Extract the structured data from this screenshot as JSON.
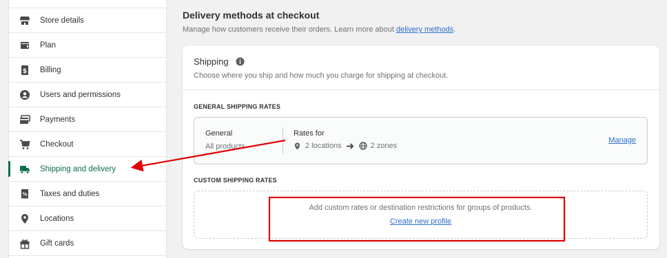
{
  "sidebar": {
    "items": [
      {
        "label": "Store details",
        "icon": "store-icon"
      },
      {
        "label": "Plan",
        "icon": "plan-icon"
      },
      {
        "label": "Billing",
        "icon": "billing-icon"
      },
      {
        "label": "Users and permissions",
        "icon": "user-icon"
      },
      {
        "label": "Payments",
        "icon": "payments-icon"
      },
      {
        "label": "Checkout",
        "icon": "cart-icon"
      },
      {
        "label": "Shipping and delivery",
        "icon": "truck-icon",
        "active": true
      },
      {
        "label": "Taxes and duties",
        "icon": "tax-icon"
      },
      {
        "label": "Locations",
        "icon": "location-pin-icon"
      },
      {
        "label": "Gift cards",
        "icon": "gift-icon"
      }
    ]
  },
  "main": {
    "title": "Delivery methods at checkout",
    "description_prefix": "Manage how customers receive their orders. Learn more about ",
    "description_link": "delivery methods",
    "description_suffix": ".",
    "shipping_card": {
      "title": "Shipping",
      "subtitle": "Choose where you ship and how much you charge for shipping at checkout.",
      "general_header": "GENERAL SHIPPING RATES",
      "general_profile": {
        "name": "General",
        "products": "All products",
        "rates_label": "Rates for",
        "locations": "2 locations",
        "zones": "2 zones",
        "manage_label": "Manage"
      },
      "custom_header": "CUSTOM SHIPPING RATES",
      "custom_text": "Add custom rates or destination restrictions for groups of products.",
      "custom_link": "Create new profile"
    }
  },
  "colors": {
    "accent_active": "#0b6e4f",
    "link": "#2c6ecb",
    "annotation_red": "#e00000"
  }
}
